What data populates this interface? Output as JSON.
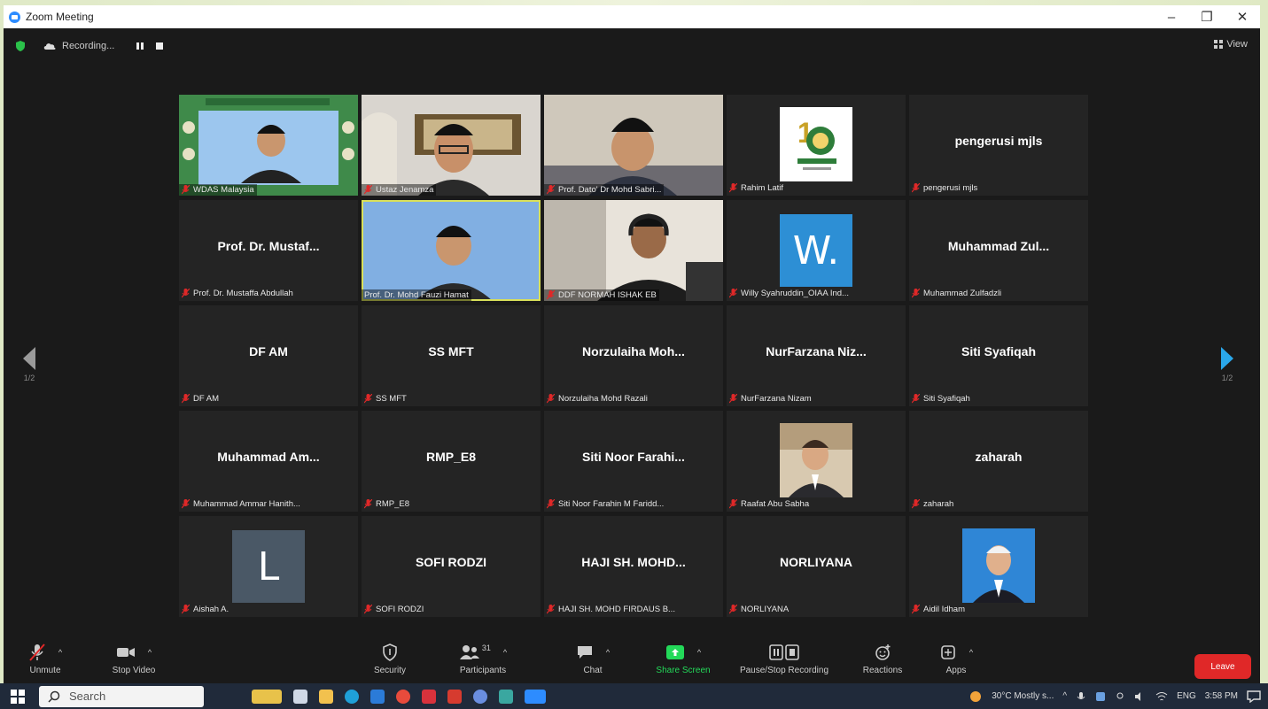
{
  "window": {
    "title": "Zoom Meeting",
    "controls": [
      "–",
      "❐",
      "✕"
    ]
  },
  "topbar": {
    "recording_label": "Recording...",
    "view_label": "View"
  },
  "navigation": {
    "left_page": "1/2",
    "right_page": "1/2"
  },
  "participants": [
    {
      "caption": "WDAS Malaysia",
      "kind": "video"
    },
    {
      "caption": "Ustaz Jenamza",
      "kind": "video"
    },
    {
      "caption": "Prof. Dato' Dr Mohd Sabri...",
      "kind": "video"
    },
    {
      "caption": "Rahim Latif",
      "kind": "photo"
    },
    {
      "caption": "pengerusi mjls",
      "display": "pengerusi mjls",
      "kind": "name"
    },
    {
      "caption": "Prof. Dr. Mustaffa Abdullah",
      "display": "Prof. Dr. Mustaf...",
      "kind": "name"
    },
    {
      "caption": "Prof. Dr. Mohd Fauzi Hamat",
      "kind": "video",
      "active": true
    },
    {
      "caption": "DDF NORMAH ISHAK EB",
      "kind": "video"
    },
    {
      "caption": "Willy Syahruddin_OIAA Ind...",
      "avatar_letter": "W.",
      "avatar_color": "#2d8fd5",
      "kind": "avatar"
    },
    {
      "caption": "Muhammad Zulfadzli",
      "display": "Muhammad  Zul...",
      "kind": "name"
    },
    {
      "caption": "DF AM",
      "display": "DF AM",
      "kind": "name"
    },
    {
      "caption": "SS MFT",
      "display": "SS MFT",
      "kind": "name"
    },
    {
      "caption": "Norzulaiha Mohd Razali",
      "display": "Norzulaiha  Moh...",
      "kind": "name"
    },
    {
      "caption": "NurFarzana Nizam",
      "display": "NurFarzana  Niz...",
      "kind": "name"
    },
    {
      "caption": "Siti Syafiqah",
      "display": "Siti Syafiqah",
      "kind": "name"
    },
    {
      "caption": "Muhammad Ammar Hanith...",
      "display": "Muhammad  Am...",
      "kind": "name"
    },
    {
      "caption": "RMP_E8",
      "display": "RMP_E8",
      "kind": "name"
    },
    {
      "caption": "Siti Noor Farahin M Faridd...",
      "display": "Siti Noor Farahi...",
      "kind": "name"
    },
    {
      "caption": "Raafat Abu Sabha",
      "kind": "photo"
    },
    {
      "caption": "zaharah",
      "display": "zaharah",
      "kind": "name"
    },
    {
      "caption": "Aishah A.",
      "avatar_letter": "L",
      "avatar_color": "#4a5866",
      "kind": "avatar"
    },
    {
      "caption": "SOFI RODZI",
      "display": "SOFI RODZI",
      "kind": "name"
    },
    {
      "caption": "HAJI SH. MOHD FIRDAUS B...",
      "display": "HAJI  SH.  MOHD...",
      "kind": "name"
    },
    {
      "caption": "NORLIYANA",
      "display": "NORLIYANA",
      "kind": "name"
    },
    {
      "caption": "Aidil Idham",
      "kind": "photo"
    }
  ],
  "toolbar": {
    "unmute": "Unmute",
    "stop_video": "Stop Video",
    "security": "Security",
    "participants": "Participants",
    "participants_count": "31",
    "chat": "Chat",
    "share_screen": "Share Screen",
    "pause_stop_recording": "Pause/Stop Recording",
    "reactions": "Reactions",
    "apps": "Apps",
    "leave": "Leave"
  },
  "taskbar": {
    "search_placeholder": "Search",
    "weather": "30°C  Mostly s...",
    "language": "ENG",
    "time": "3:58 PM"
  },
  "colors": {
    "leave": "#e02828",
    "share_screen": "#23d959",
    "active_speaker": "#d9e05a",
    "mic_off": "#e02828"
  }
}
